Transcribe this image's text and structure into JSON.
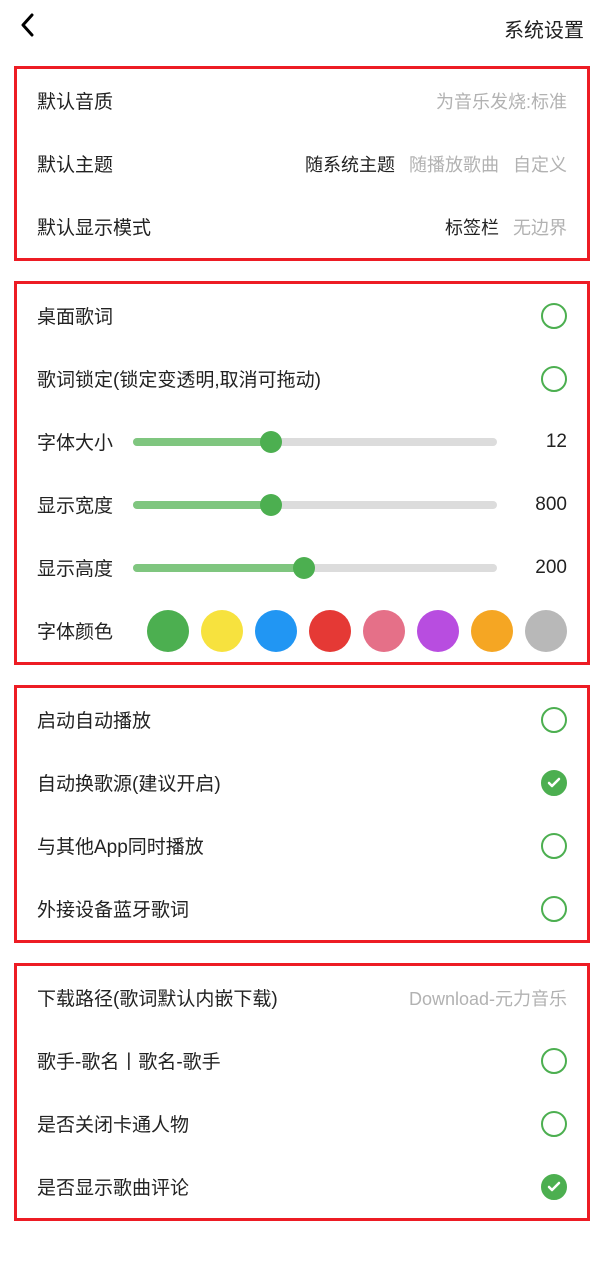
{
  "header": {
    "title": "系统设置"
  },
  "sectionA": {
    "quality": {
      "label": "默认音质",
      "value": "为音乐发烧:标准"
    },
    "theme": {
      "label": "默认主题",
      "options": [
        "随系统主题",
        "随播放歌曲",
        "自定义"
      ],
      "selected": 0
    },
    "display": {
      "label": "默认显示模式",
      "options": [
        "标签栏",
        "无边界"
      ],
      "selected": 0
    }
  },
  "sectionB": {
    "desktopLyrics": {
      "label": "桌面歌词",
      "checked": false
    },
    "lockLyrics": {
      "label": "歌词锁定(锁定变透明,取消可拖动)",
      "checked": false
    },
    "fontSize": {
      "label": "字体大小",
      "value": "12",
      "pct": 38
    },
    "width": {
      "label": "显示宽度",
      "value": "800",
      "pct": 38
    },
    "height": {
      "label": "显示高度",
      "value": "200",
      "pct": 47
    },
    "fontColor": {
      "label": "字体颜色",
      "colors": [
        "#4caf50",
        "#f7e23e",
        "#2196f3",
        "#e53935",
        "#e57088",
        "#b84de0",
        "#f5a623",
        "#b8b8b8"
      ]
    }
  },
  "sectionC": {
    "autoplay": {
      "label": "启动自动播放",
      "checked": false
    },
    "autoSource": {
      "label": "自动换歌源(建议开启)",
      "checked": true
    },
    "simultaneous": {
      "label": "与其他App同时播放",
      "checked": false
    },
    "btLyrics": {
      "label": "外接设备蓝牙歌词",
      "checked": false
    }
  },
  "sectionD": {
    "downloadPath": {
      "label": "下载路径(歌词默认内嵌下载)",
      "value": "Download-元力音乐"
    },
    "nameFormat": {
      "label": "歌手-歌名丨歌名-歌手",
      "checked": false
    },
    "closeCartoon": {
      "label": "是否关闭卡通人物",
      "checked": false
    },
    "showComments": {
      "label": "是否显示歌曲评论",
      "checked": true
    }
  }
}
